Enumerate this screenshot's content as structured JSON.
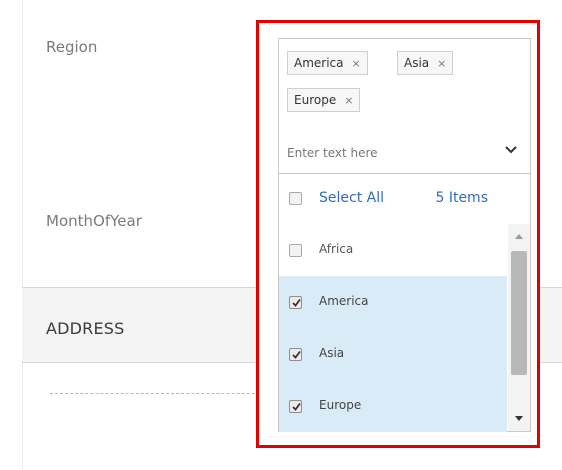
{
  "form": {
    "region_label": "Region",
    "month_label": "MonthOfYear",
    "section_title": "ADDRESS"
  },
  "multiselect": {
    "chips": [
      {
        "label": "America",
        "remove": "×"
      },
      {
        "label": "Asia",
        "remove": "×"
      },
      {
        "label": "Europe",
        "remove": "×"
      }
    ],
    "placeholder": "Enter text here",
    "select_all_label": "Select All",
    "items_count": "5 Items",
    "options": [
      {
        "label": "Africa",
        "checked": false
      },
      {
        "label": "America",
        "checked": true
      },
      {
        "label": "Asia",
        "checked": true
      },
      {
        "label": "Europe",
        "checked": true
      }
    ]
  },
  "colors": {
    "highlight": "#e00000",
    "accent": "#2e6db8",
    "selected_row": "#daebf8"
  },
  "icons": {
    "dropdown": "chevron-down-icon",
    "remove": "close-icon",
    "scroll_up": "caret-up-icon",
    "scroll_down": "caret-down-icon"
  }
}
